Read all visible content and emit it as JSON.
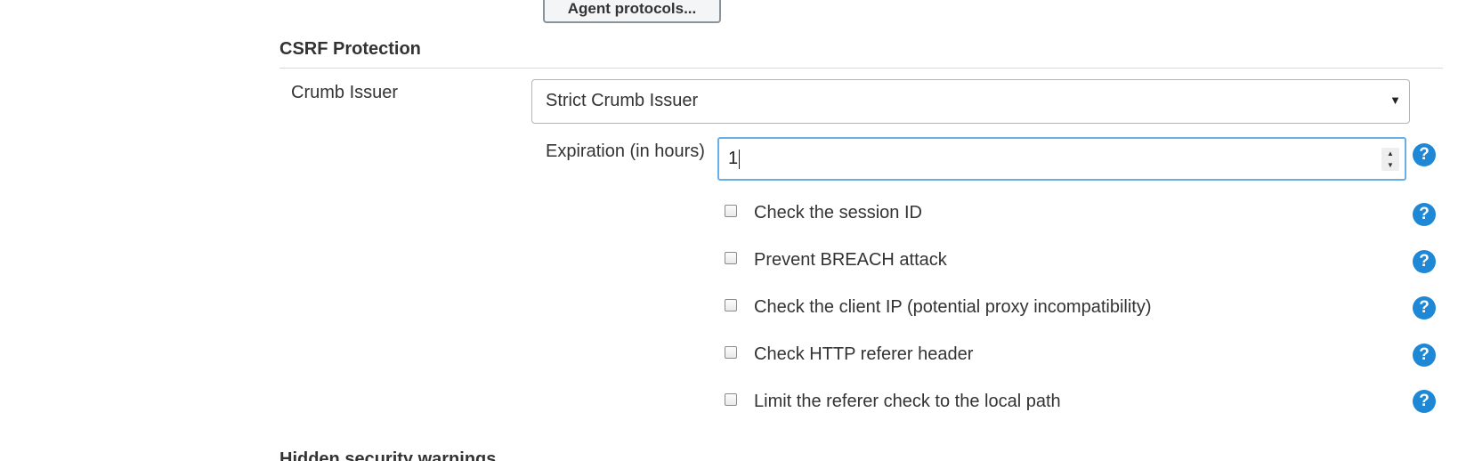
{
  "top_button_label": "Agent protocols...",
  "section_title": "CSRF Protection",
  "crumb_issuer": {
    "label": "Crumb Issuer",
    "selected": "Strict Crumb Issuer"
  },
  "expiration": {
    "label": "Expiration (in hours)",
    "value": "1"
  },
  "options": [
    {
      "label": "Check the session ID",
      "checked": false
    },
    {
      "label": "Prevent BREACH attack",
      "checked": false
    },
    {
      "label": "Check the client IP (potential proxy incompatibility)",
      "checked": false
    },
    {
      "label": "Check HTTP referer header",
      "checked": false
    },
    {
      "label": "Limit the referer check to the local path",
      "checked": false
    }
  ],
  "next_section_title": "Hidden security warnings",
  "help_glyph": "?",
  "icons": {
    "help": "help-icon",
    "dropdown": "chevron-down-icon"
  },
  "colors": {
    "help_icon": "#1e88d6",
    "focus_border": "#66afe9"
  }
}
